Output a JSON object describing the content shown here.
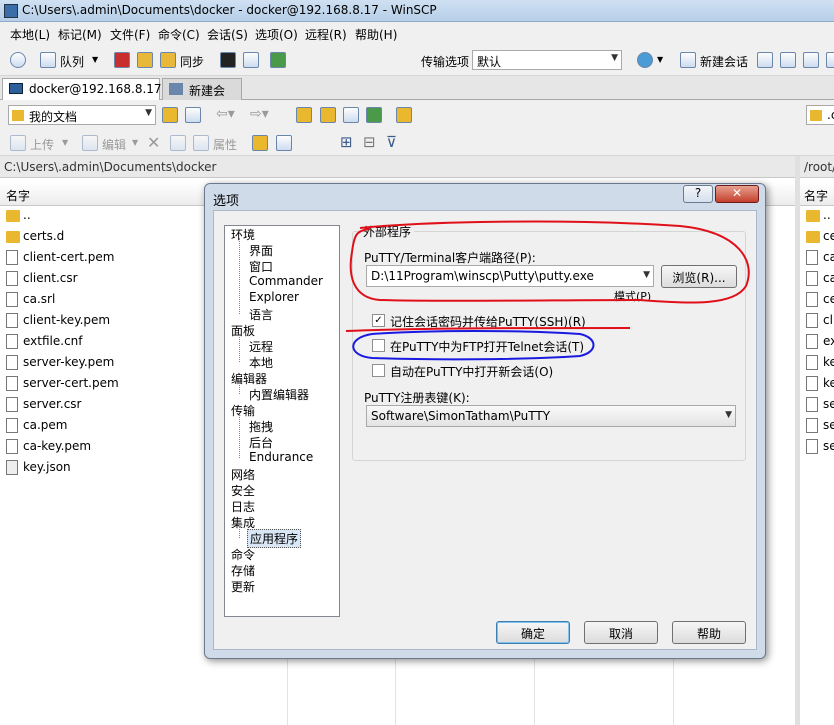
{
  "window": {
    "title": "C:\\Users\\.admin\\Documents\\docker - docker@192.168.8.17 - WinSCP"
  },
  "menu": [
    "本地(L)",
    "标记(M)",
    "文件(F)",
    "命令(C)",
    "会话(S)",
    "选项(O)",
    "远程(R)",
    "帮助(H)"
  ],
  "toolbar": {
    "queue_label": "队列",
    "sync_label": "同步",
    "transfer_label": "传输选项",
    "transfer_value": "默认",
    "new_session_label": "新建会话"
  },
  "tabs": {
    "session": "docker@192.168.8.17",
    "new_session": "新建会话"
  },
  "local": {
    "dir_combo": "我的文档",
    "upload_label": "上传",
    "edit_label": "编辑",
    "props_label": "属性",
    "path": "C:\\Users\\.admin\\Documents\\docker",
    "col_name": "名字",
    "files": [
      "..",
      "certs.d",
      "client-cert.pem",
      "client.csr",
      "ca.srl",
      "client-key.pem",
      "extfile.cnf",
      "server-key.pem",
      "server-cert.pem",
      "server.csr",
      "ca.pem",
      "ca-key.pem",
      "key.json"
    ]
  },
  "remote": {
    "dir_combo": ".c",
    "path": "/root/",
    "col_name": "名字",
    "files": [
      "..",
      "ce",
      "ca",
      "ca",
      "ce",
      "cli",
      "ex",
      "ke",
      "ke",
      "se",
      "se",
      "se"
    ]
  },
  "dialog": {
    "title": "选项",
    "help_glyph": "?",
    "close_glyph": "✕",
    "tree": [
      {
        "label": "环境",
        "indent": 0
      },
      {
        "label": "界面",
        "indent": 1
      },
      {
        "label": "窗口",
        "indent": 1
      },
      {
        "label": "Commander",
        "indent": 1
      },
      {
        "label": "Explorer",
        "indent": 1
      },
      {
        "label": "语言",
        "indent": 1
      },
      {
        "label": "面板",
        "indent": 0
      },
      {
        "label": "远程",
        "indent": 1
      },
      {
        "label": "本地",
        "indent": 1
      },
      {
        "label": "编辑器",
        "indent": 0
      },
      {
        "label": "内置编辑器",
        "indent": 1
      },
      {
        "label": "传输",
        "indent": 0
      },
      {
        "label": "拖拽",
        "indent": 1
      },
      {
        "label": "后台",
        "indent": 1
      },
      {
        "label": "Endurance",
        "indent": 1
      },
      {
        "label": "网络",
        "indent": 0
      },
      {
        "label": "安全",
        "indent": 0
      },
      {
        "label": "日志",
        "indent": 0
      },
      {
        "label": "集成",
        "indent": 0
      },
      {
        "label": "应用程序",
        "indent": 1,
        "selected": true
      },
      {
        "label": "命令",
        "indent": 0
      },
      {
        "label": "存储",
        "indent": 0
      },
      {
        "label": "更新",
        "indent": 0
      }
    ],
    "group_title": "外部程序",
    "putty_path_label": "PuTTY/Terminal客户端路径(P):",
    "putty_path_value": "D:\\11Program\\winscp\\Putty\\putty.exe",
    "browse_label": "浏览(R)...",
    "pattern_label": "模式(P)",
    "opt_remember_password": "记住会话密码并传给PuTTY(SSH)(R)",
    "opt_remember_password_checked": true,
    "opt_telnet_for_ftp": "在PuTTY中为FTP打开Telnet会话(T)",
    "opt_telnet_for_ftp_checked": false,
    "opt_open_new_session": "自动在PuTTY中打开新会话(O)",
    "opt_open_new_session_checked": false,
    "registry_label": "PuTTY注册表键(K):",
    "registry_value": "Software\\SimonTatham\\PuTTY",
    "ok_label": "确定",
    "cancel_label": "取消",
    "help_label": "帮助"
  },
  "colors": {
    "annotation_red": "#e0101a",
    "annotation_blue": "#1a1ae0",
    "accent": "#3c7fb1"
  }
}
